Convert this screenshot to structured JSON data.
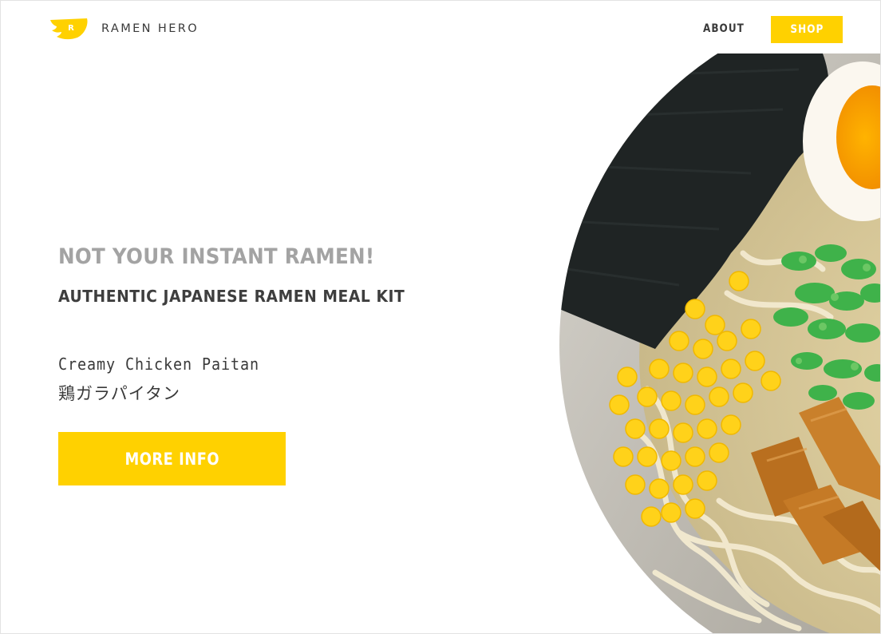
{
  "header": {
    "brand": "RAMEN HERO",
    "logo_letter": "R",
    "nav": {
      "about_label": "ABOUT",
      "shop_label": "SHOP"
    }
  },
  "hero": {
    "tagline": "NOT YOUR INSTANT RAMEN!",
    "subtitle": "AUTHENTIC JAPANESE RAMEN MEAL KIT",
    "product_name": "Creamy Chicken Paitan",
    "product_name_jp": "鶏ガラパイタン",
    "cta_label": "MORE INFO"
  },
  "image": {
    "icon": "ramen-bowl-photo"
  },
  "colors": {
    "accent": "#ffd100",
    "heading_gray": "#a3a3a3",
    "text_dark": "#3a3a3a"
  }
}
